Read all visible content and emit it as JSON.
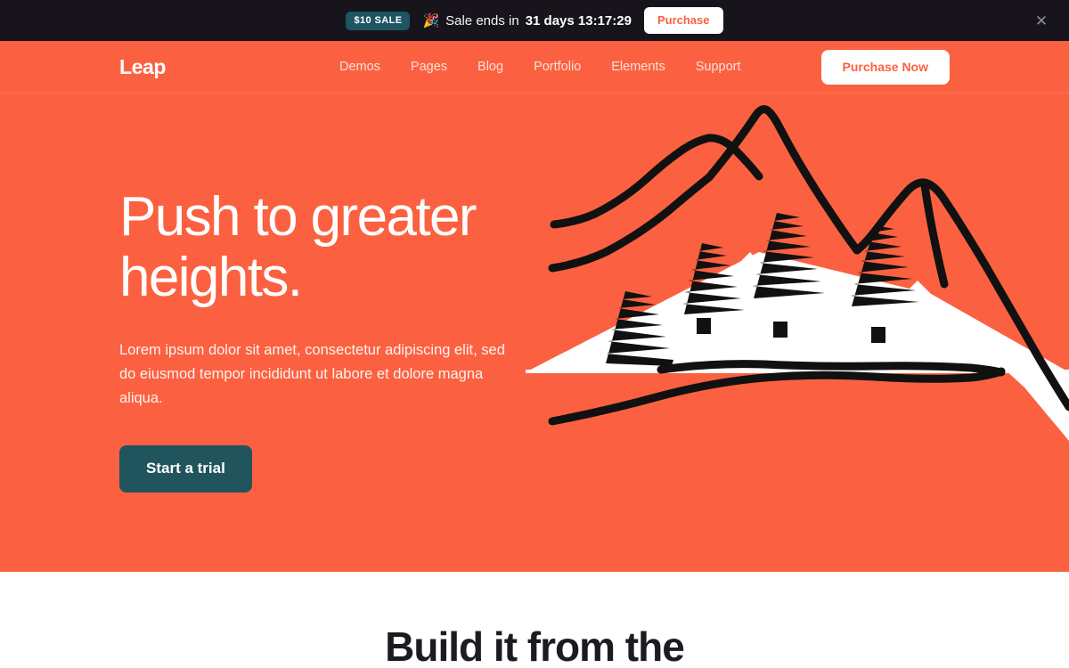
{
  "promo": {
    "badge": "$10 SALE",
    "emoji": "🎉",
    "emoji_name": "party-popper-icon",
    "message": "Sale ends in",
    "countdown": "31 days 13:17:29",
    "button": "Purchase",
    "close_icon": "✕",
    "background": "#17141c",
    "badge_color": "#1d5560"
  },
  "header": {
    "brand": "Leap",
    "nav": [
      {
        "label": "Demos"
      },
      {
        "label": "Pages"
      },
      {
        "label": "Blog"
      },
      {
        "label": "Portfolio"
      },
      {
        "label": "Elements"
      },
      {
        "label": "Support"
      }
    ],
    "cta": "Purchase Now"
  },
  "hero": {
    "title": "Push to greater heights.",
    "subtitle": "Lorem ipsum dolor sit amet, consectetur adipiscing elit, sed do eiusmod tempor incididunt ut labore et dolore magna aliqua.",
    "button": "Start a trial",
    "background": "#fb6140",
    "button_color": "#21555e",
    "illustration": "hand-drawn-mountain-with-pine-trees"
  },
  "next_section": {
    "heading": "Build it from the"
  }
}
